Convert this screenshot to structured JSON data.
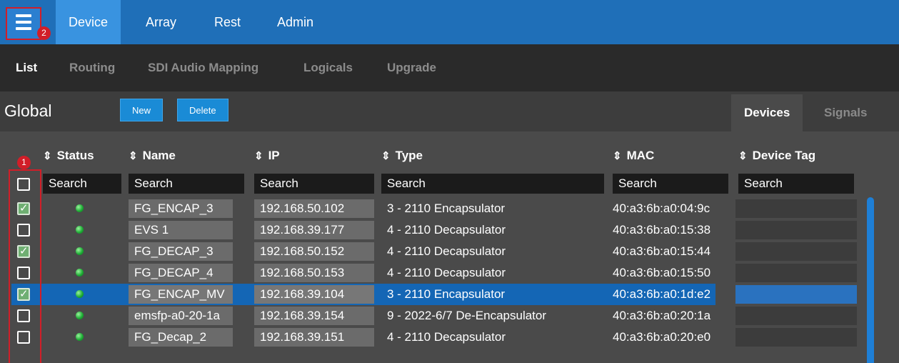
{
  "topnav": {
    "menu_badge": "2",
    "items": [
      "Device",
      "Array",
      "Rest",
      "Admin"
    ],
    "active": "Device"
  },
  "subnav": {
    "items": [
      "List",
      "Routing",
      "SDI Audio Mapping",
      "Logicals",
      "Upgrade"
    ],
    "active": "List"
  },
  "toolbar": {
    "title": "Global",
    "new_label": "New",
    "delete_label": "Delete",
    "tabs": [
      "Devices",
      "Signals"
    ],
    "active_tab": "Devices"
  },
  "table": {
    "select_badge": "1",
    "columns": [
      "Status",
      "Name",
      "IP",
      "Type",
      "MAC",
      "Device Tag"
    ],
    "search_placeholders": [
      "Search",
      "Search",
      "Search",
      "Search",
      "Search",
      "Search"
    ],
    "rows": [
      {
        "checked": true,
        "name": "FG_ENCAP_3",
        "ip": "192.168.50.102",
        "type": "3 - 2110 Encapsulator",
        "mac": "40:a3:6b:a0:04:9c",
        "tag": ""
      },
      {
        "checked": false,
        "name": "EVS 1",
        "ip": "192.168.39.177",
        "type": "4 - 2110 Decapsulator",
        "mac": "40:a3:6b:a0:15:38",
        "tag": ""
      },
      {
        "checked": true,
        "name": "FG_DECAP_3",
        "ip": "192.168.50.152",
        "type": "4 - 2110 Decapsulator",
        "mac": "40:a3:6b:a0:15:44",
        "tag": ""
      },
      {
        "checked": false,
        "name": "FG_DECAP_4",
        "ip": "192.168.50.153",
        "type": "4 - 2110 Decapsulator",
        "mac": "40:a3:6b:a0:15:50",
        "tag": ""
      },
      {
        "checked": true,
        "name": "FG_ENCAP_MV",
        "ip": "192.168.39.104",
        "type": "3 - 2110 Encapsulator",
        "mac": "40:a3:6b:a0:1d:e2",
        "tag": "",
        "selected": true
      },
      {
        "checked": false,
        "name": "emsfp-a0-20-1a",
        "ip": "192.168.39.154",
        "type": "9 - 2022-6/7 De-Encapsulator",
        "mac": "40:a3:6b:a0:20:1a",
        "tag": ""
      },
      {
        "checked": false,
        "name": "FG_Decap_2",
        "ip": "192.168.39.151",
        "type": "4 - 2110 Decapsulator",
        "mac": "40:a3:6b:a0:20:e0",
        "tag": ""
      }
    ]
  },
  "colors": {
    "accent": "#1f6fb8",
    "selected_row": "#1466b5",
    "highlight_outline": "#d11e28",
    "status_ok": "#1fae36"
  },
  "icons": {
    "menu": "hamburger-icon",
    "sort": "sort-icon",
    "status": "status-led-icon"
  }
}
